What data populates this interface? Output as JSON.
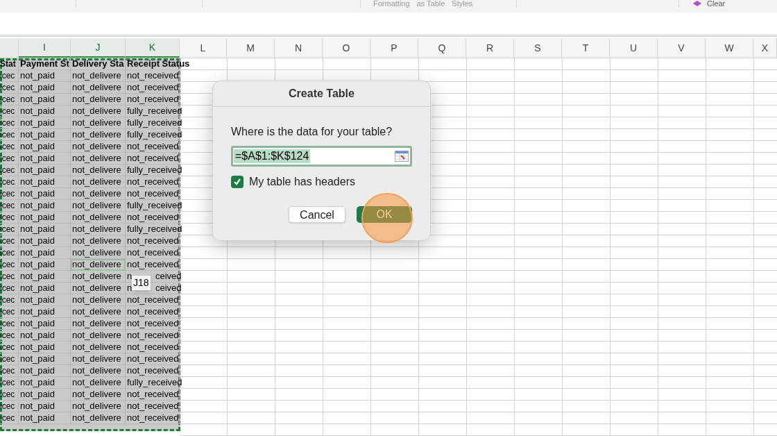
{
  "ribbon": {
    "groups": [
      {
        "labels": [
          "Formatting",
          "as Table",
          "Styles"
        ]
      }
    ],
    "clear_label": "Clear"
  },
  "columns": [
    {
      "letter": "I",
      "selected": true
    },
    {
      "letter": "J",
      "selected": true
    },
    {
      "letter": "K",
      "selected": true
    },
    {
      "letter": "L",
      "selected": false
    },
    {
      "letter": "M",
      "selected": false
    },
    {
      "letter": "N",
      "selected": false
    },
    {
      "letter": "O",
      "selected": false
    },
    {
      "letter": "P",
      "selected": false
    },
    {
      "letter": "Q",
      "selected": false
    },
    {
      "letter": "R",
      "selected": false
    },
    {
      "letter": "S",
      "selected": false
    },
    {
      "letter": "T",
      "selected": false
    },
    {
      "letter": "U",
      "selected": false
    },
    {
      "letter": "V",
      "selected": false
    },
    {
      "letter": "W",
      "selected": false
    },
    {
      "letter": "X",
      "selected": false
    }
  ],
  "header_row": [
    "Stat",
    "Payment St",
    "Delivery Sta",
    "Receipt Status"
  ],
  "rows": [
    {
      "cells": [
        "icec",
        "not_paid",
        "not_delivere",
        "not_received"
      ],
      "selected": false
    },
    {
      "cells": [
        "icec",
        "not_paid",
        "not_delivere",
        "not_received"
      ],
      "selected": false
    },
    {
      "cells": [
        "icec",
        "not_paid",
        "not_delivere",
        "not_received"
      ],
      "selected": false
    },
    {
      "cells": [
        "icec",
        "not_paid",
        "not_delivere",
        "fully_received"
      ],
      "selected": false
    },
    {
      "cells": [
        "icec",
        "not_paid",
        "not_delivere",
        "fully_received"
      ],
      "selected": false
    },
    {
      "cells": [
        "icec",
        "not_paid",
        "not_delivere",
        "fully_received"
      ],
      "selected": false
    },
    {
      "cells": [
        "icec",
        "not_paid",
        "not_delivere",
        "not_received"
      ],
      "selected": false
    },
    {
      "cells": [
        "icec",
        "not_paid",
        "not_delivere",
        "not_received"
      ],
      "selected": false
    },
    {
      "cells": [
        "icec",
        "not_paid",
        "not_delivere",
        "fully_received"
      ],
      "selected": false
    },
    {
      "cells": [
        "icec",
        "not_paid",
        "not_delivere",
        "not_received"
      ],
      "selected": false
    },
    {
      "cells": [
        "icec",
        "not_paid",
        "not_delivere",
        "not_received"
      ],
      "selected": false
    },
    {
      "cells": [
        "icec",
        "not_paid",
        "not_delivere",
        "fully_received"
      ],
      "selected": false
    },
    {
      "cells": [
        "icec",
        "not_paid",
        "not_delivere",
        "not_received"
      ],
      "selected": false
    },
    {
      "cells": [
        "icec",
        "not_paid",
        "not_delivere",
        "fully_received"
      ],
      "selected": false
    },
    {
      "cells": [
        "icec",
        "not_paid",
        "not_delivere",
        "not_received"
      ],
      "selected": false
    },
    {
      "cells": [
        "icec",
        "not_paid",
        "not_delivere",
        "not_received"
      ],
      "selected": false
    },
    {
      "cells": [
        "icec",
        "not_paid",
        "not_delivere",
        "not_received"
      ],
      "selected": true
    },
    {
      "cells": [
        "icec",
        "not_paid",
        "not_delivere",
        "n",
        "ceived"
      ],
      "selected": false
    },
    {
      "cells": [
        "icec",
        "not_paid",
        "not_delivere",
        "n",
        "ceived"
      ],
      "selected": false
    },
    {
      "cells": [
        "icec",
        "not_paid",
        "not_delivere",
        "not_received"
      ],
      "selected": false
    },
    {
      "cells": [
        "icec",
        "not_paid",
        "not_delivere",
        "not_received"
      ],
      "selected": false
    },
    {
      "cells": [
        "icec",
        "not_paid",
        "not_delivere",
        "not_received"
      ],
      "selected": false
    },
    {
      "cells": [
        "icec",
        "not_paid",
        "not_delivere",
        "not_received"
      ],
      "selected": false
    },
    {
      "cells": [
        "icec",
        "not_paid",
        "not_delivere",
        "not_received"
      ],
      "selected": false
    },
    {
      "cells": [
        "icec",
        "not_paid",
        "not_delivere",
        "not_received"
      ],
      "selected": false
    },
    {
      "cells": [
        "icec",
        "not_paid",
        "not_delivere",
        "not_received"
      ],
      "selected": false
    },
    {
      "cells": [
        "icec",
        "not_paid",
        "not_delivere",
        "fully_received"
      ],
      "selected": false
    },
    {
      "cells": [
        "icec",
        "not_paid",
        "not_delivere",
        "not_received"
      ],
      "selected": false
    },
    {
      "cells": [
        "icec",
        "not_paid",
        "not_delivere",
        "not_received"
      ],
      "selected": false
    },
    {
      "cells": [
        "icec",
        "not_paid",
        "not_delivere",
        "not_received"
      ],
      "selected": false
    }
  ],
  "tooltip": "J18",
  "dialog": {
    "title": "Create Table",
    "prompt": "Where is the data for your table?",
    "range_value": "=$A$1:$K$124",
    "headers_checkbox": {
      "label": "My table has headers",
      "checked": true
    },
    "buttons": [
      {
        "label": "Cancel",
        "kind": "secondary"
      },
      {
        "label": "OK",
        "kind": "primary"
      }
    ]
  }
}
